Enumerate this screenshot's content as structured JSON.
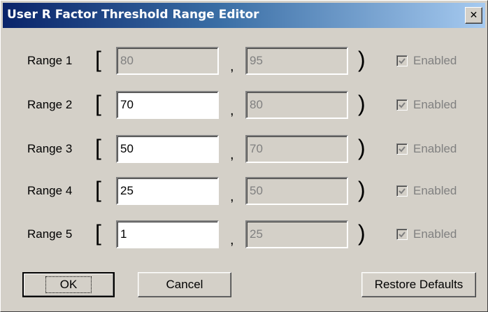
{
  "window": {
    "title": "User R Factor Threshold Range Editor",
    "close_glyph": "✕"
  },
  "ranges": [
    {
      "label": "Range 1",
      "lower": "80",
      "upper": "95",
      "lower_enabled": false,
      "enabled_label": "Enabled",
      "enabled_checked": true
    },
    {
      "label": "Range 2",
      "lower": "70",
      "upper": "80",
      "lower_enabled": true,
      "enabled_label": "Enabled",
      "enabled_checked": true
    },
    {
      "label": "Range 3",
      "lower": "50",
      "upper": "70",
      "lower_enabled": true,
      "enabled_label": "Enabled",
      "enabled_checked": true
    },
    {
      "label": "Range 4",
      "lower": "25",
      "upper": "50",
      "lower_enabled": true,
      "enabled_label": "Enabled",
      "enabled_checked": true
    },
    {
      "label": "Range 5",
      "lower": "1",
      "upper": "25",
      "lower_enabled": true,
      "enabled_label": "Enabled",
      "enabled_checked": true
    }
  ],
  "symbols": {
    "open_bracket": "[",
    "comma": ",",
    "close_paren": ")"
  },
  "buttons": {
    "ok": "OK",
    "cancel": "Cancel",
    "restore": "Restore Defaults"
  }
}
